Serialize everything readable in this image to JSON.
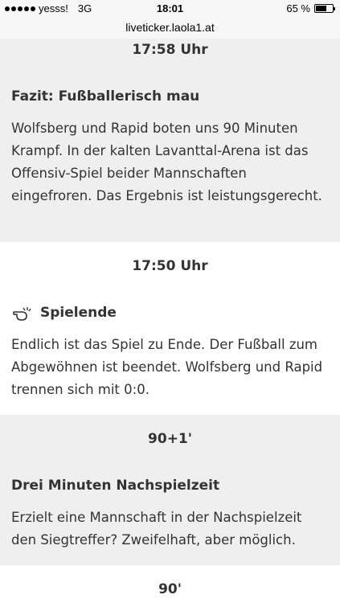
{
  "status_bar": {
    "carrier": "yesss!",
    "network": "3G",
    "time": "18:01",
    "battery_percent": "65 %",
    "battery_level": 0.65
  },
  "browser": {
    "url": "liveticker.laola1.at"
  },
  "ticker": [
    {
      "time": "17:58 Uhr",
      "headline": "Fazit: Fußballerisch mau",
      "text": "Wolfsberg und Rapid boten uns 90 Minuten Krampf. In der kalten Lavanttal-Arena ist das Offensiv-Spiel beider Mannschaften eingefroren. Das Ergebnis ist leistungsgerecht."
    },
    {
      "time": "17:50 Uhr",
      "icon": "whistle-icon",
      "headline": "Spielende",
      "text": "Endlich ist das Spiel zu Ende. Der Fußball zum Abgewöhnen ist beendet. Wolfsberg und Rapid trennen sich mit 0:0."
    },
    {
      "time": "90+1'",
      "headline": "Drei Minuten Nachspielzeit",
      "text": "Erzielt eine Mannschaft in der Nachspielzeit den Siegtreffer? Zweifelhaft, aber möglich."
    },
    {
      "time": "90'"
    }
  ],
  "colors": {
    "gray_bg": "#efefef",
    "white_bg": "#ffffff",
    "text": "#333333"
  }
}
